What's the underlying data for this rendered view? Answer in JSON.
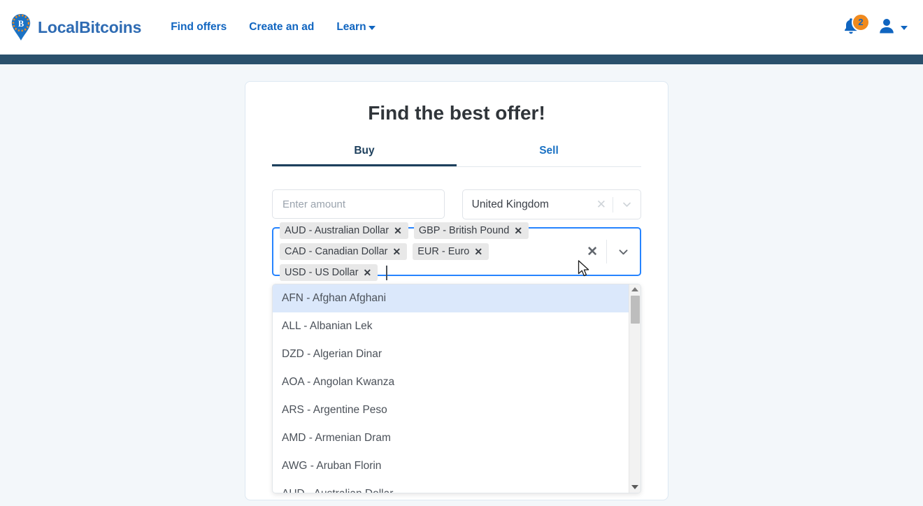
{
  "header": {
    "brand_name": "LocalBitcoins",
    "logo_icon": "localbitcoins-pin-icon",
    "nav": [
      {
        "label": "Find offers",
        "icon": "",
        "has_caret": false
      },
      {
        "label": "Create an ad",
        "icon": "",
        "has_caret": false
      },
      {
        "label": "Learn",
        "icon": "chevron-down-icon",
        "has_caret": true
      }
    ],
    "notifications": {
      "icon": "bell-icon",
      "count": "2"
    },
    "account": {
      "icon": "user-icon",
      "caret_icon": "chevron-down-icon"
    }
  },
  "card": {
    "title": "Find the best offer!",
    "tabs": [
      {
        "label": "Buy",
        "active": true
      },
      {
        "label": "Sell",
        "active": false
      }
    ],
    "amount": {
      "value": "",
      "placeholder": "Enter amount"
    },
    "country": {
      "value": "United Kingdom",
      "clear_icon": "close-icon",
      "chevron_icon": "chevron-down-icon"
    },
    "currencies": {
      "tags": [
        {
          "label": "AUD - Australian Dollar",
          "remove_icon": "close-icon"
        },
        {
          "label": "GBP - British Pound",
          "remove_icon": "close-icon"
        },
        {
          "label": "CAD - Canadian Dollar",
          "remove_icon": "close-icon"
        },
        {
          "label": "EUR - Euro",
          "remove_icon": "close-icon"
        },
        {
          "label": "USD - US Dollar",
          "remove_icon": "close-icon"
        }
      ],
      "input_value": "",
      "clear_all_icon": "close-icon",
      "chevron_icon": "chevron-down-icon",
      "focused": true
    },
    "dropdown": {
      "options": [
        {
          "label": "AFN - Afghan Afghani",
          "highlighted": true
        },
        {
          "label": "ALL - Albanian Lek",
          "highlighted": false
        },
        {
          "label": "DZD - Algerian Dinar",
          "highlighted": false
        },
        {
          "label": "AOA - Angolan Kwanza",
          "highlighted": false
        },
        {
          "label": "ARS - Argentine Peso",
          "highlighted": false
        },
        {
          "label": "AMD - Armenian Dram",
          "highlighted": false
        },
        {
          "label": "AWG - Aruban Florin",
          "highlighted": false
        },
        {
          "label": "AUD - Australian Dollar",
          "highlighted": false
        }
      ],
      "scrollbar": {
        "up_icon": "triangle-up-icon",
        "down_icon": "triangle-down-icon"
      }
    }
  },
  "colors": {
    "brand_blue": "#2e6bb3",
    "link_blue": "#1065c0",
    "badge_orange": "#f08a1e",
    "navy": "#2a506c",
    "focus_blue": "#2684ff",
    "highlight_blue": "#dbe8fb",
    "page_bg": "#f3f7fa"
  },
  "cursor": {
    "icon": "mouse-pointer-icon"
  }
}
